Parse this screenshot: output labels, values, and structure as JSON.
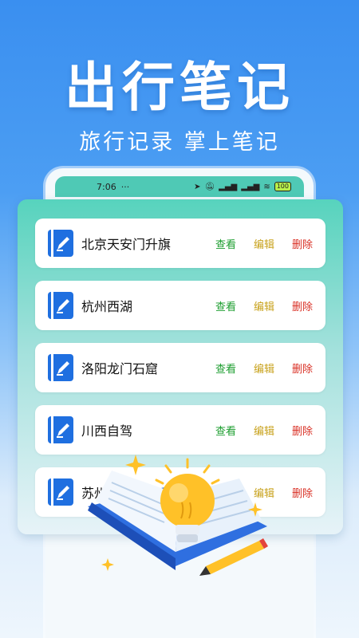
{
  "hero": {
    "title": "出行笔记",
    "subtitle": "旅行记录 掌上笔记"
  },
  "status_bar": {
    "time": "7:06",
    "dots": "···",
    "battery": "100"
  },
  "notes": [
    {
      "title": "北京天安门升旗"
    },
    {
      "title": "杭州西湖"
    },
    {
      "title": "洛阳龙门石窟"
    },
    {
      "title": "川西自驾"
    },
    {
      "title": "苏州游玩"
    }
  ],
  "actions": {
    "view": "查看",
    "edit": "编辑",
    "delete": "删除"
  },
  "colors": {
    "background_top": "#3a8ff0",
    "card_accent": "#57d3bd",
    "note_icon": "#1f6fe0",
    "view": "#1b9d2e",
    "edit": "#c8a21c",
    "delete": "#d93025"
  },
  "icons": [
    "note-pencil-icon",
    "location-icon",
    "mute-icon",
    "signal-icon",
    "wifi-icon",
    "battery-icon",
    "lightbulb-icon",
    "book-icon",
    "pencil-icon",
    "sparkle-icon"
  ]
}
